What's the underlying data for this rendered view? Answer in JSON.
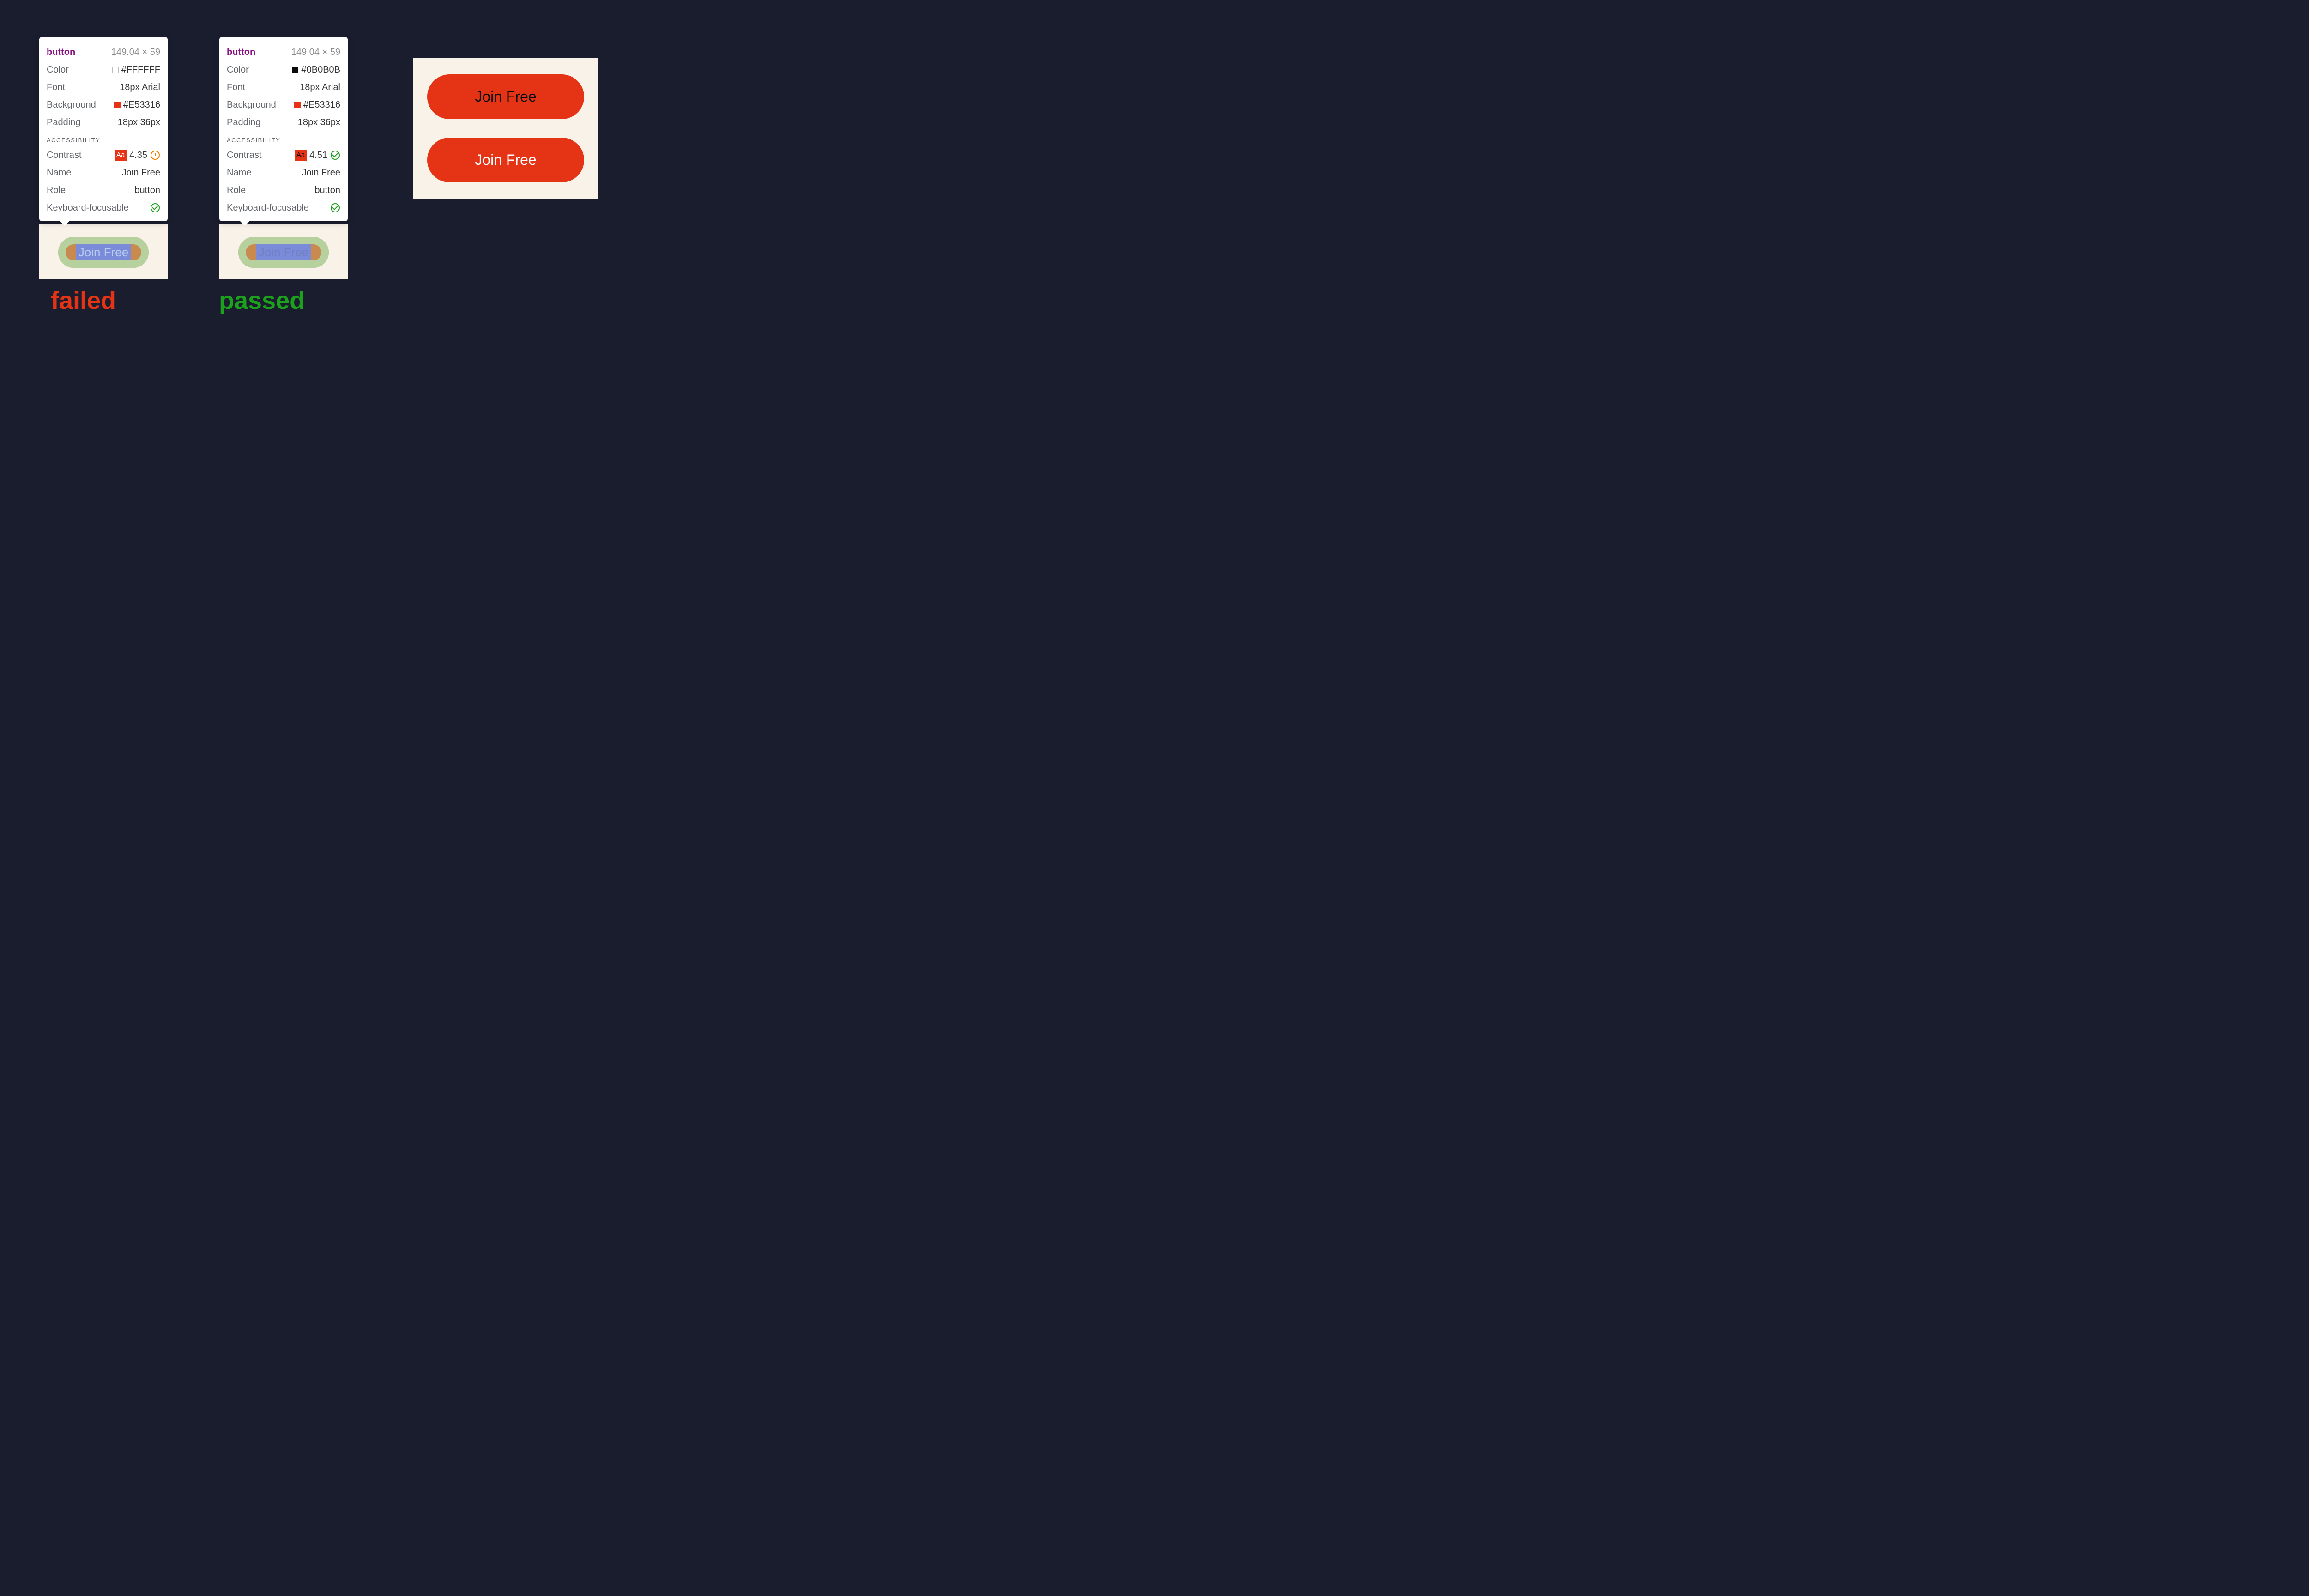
{
  "failed_panel": {
    "element": "button",
    "dimensions": "149.04 × 59",
    "props": {
      "color_label": "Color",
      "color_value": "#FFFFFF",
      "color_swatch": "#FFFFFF",
      "font_label": "Font",
      "font_value": "18px Arial",
      "bg_label": "Background",
      "bg_value": "#E53316",
      "bg_swatch": "#E53316",
      "padding_label": "Padding",
      "padding_value": "18px 36px"
    },
    "a11y_header": "ACCESSIBILITY",
    "a11y": {
      "contrast_label": "Contrast",
      "contrast_aa": "Aa",
      "contrast_value": "4.35",
      "contrast_status": "warn",
      "name_label": "Name",
      "name_value": "Join Free",
      "role_label": "Role",
      "role_value": "button",
      "focusable_label": "Keyboard-focusable",
      "focusable_status": "pass"
    },
    "button_text": "Join Free",
    "verdict": "failed"
  },
  "passed_panel": {
    "element": "button",
    "dimensions": "149.04 × 59",
    "props": {
      "color_label": "Color",
      "color_value": "#0B0B0B",
      "color_swatch": "#0B0B0B",
      "font_label": "Font",
      "font_value": "18px Arial",
      "bg_label": "Background",
      "bg_value": "#E53316",
      "bg_swatch": "#E53316",
      "padding_label": "Padding",
      "padding_value": "18px 36px"
    },
    "a11y_header": "ACCESSIBILITY",
    "a11y": {
      "contrast_label": "Contrast",
      "contrast_aa": "Aa",
      "contrast_value": "4.51",
      "contrast_status": "pass",
      "name_label": "Name",
      "name_value": "Join Free",
      "role_label": "Role",
      "role_value": "button",
      "focusable_label": "Keyboard-focusable",
      "focusable_status": "pass"
    },
    "button_text": "Join Free",
    "verdict": "passed"
  },
  "comparison": {
    "button_dark_text": "Join Free",
    "button_light_text": "Join Free"
  }
}
